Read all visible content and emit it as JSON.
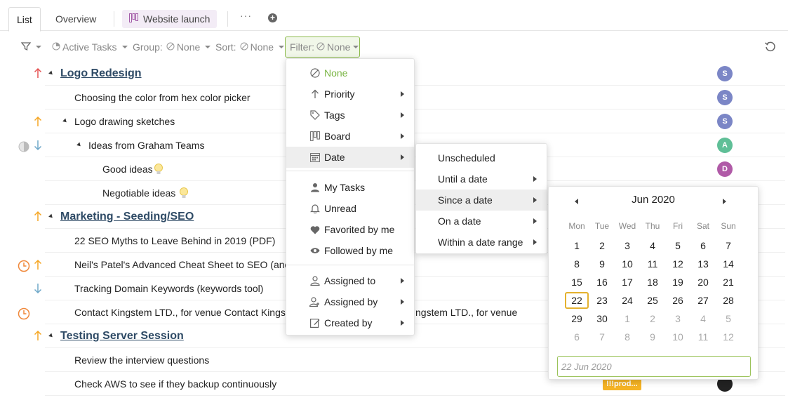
{
  "tabs": {
    "list": "List",
    "overview": "Overview",
    "project": "Website launch",
    "more": "···"
  },
  "toolbar": {
    "active_tasks": "Active Tasks",
    "group": "Group:",
    "group_value": "None",
    "sort": "Sort:",
    "sort_value": "None",
    "filter": "Filter:",
    "filter_value": "None"
  },
  "rows": [
    {
      "text": "Logo Redesign",
      "avatar": "S"
    },
    {
      "text": "Choosing the color from hex color picker",
      "avatar": "S"
    },
    {
      "text": "Logo drawing sketches",
      "avatar": "S"
    },
    {
      "text": "Ideas from Graham Teams",
      "avatar": "A"
    },
    {
      "text": "Good ideas",
      "avatar": "D"
    },
    {
      "text": "Negotiable ideas"
    },
    {
      "text": "Marketing - Seeding/SEO"
    },
    {
      "text": "22 SEO Myths to Leave Behind in 2019 (PDF)"
    },
    {
      "text": "Neil's Patel's Advanced Cheat Sheet to SEO (and"
    },
    {
      "text": "Tracking Domain Keywords (keywords tool)"
    },
    {
      "text": "Contact Kingstem LTD., for venue Contact Kingst",
      "text_tail": "ngstem LTD., for venue"
    },
    {
      "text": "Testing Server Session"
    },
    {
      "text": "Review the interview questions"
    },
    {
      "text": "Check AWS to see if they backup continuously",
      "tag": "!!!prod..."
    }
  ],
  "filter_menu": {
    "none": "None",
    "priority": "Priority",
    "tags": "Tags",
    "board": "Board",
    "date": "Date",
    "my_tasks": "My Tasks",
    "unread": "Unread",
    "favorited": "Favorited by me",
    "followed": "Followed by me",
    "assigned_to": "Assigned to",
    "assigned_by": "Assigned by",
    "created_by": "Created by"
  },
  "date_menu": {
    "unscheduled": "Unscheduled",
    "until": "Until a date",
    "since": "Since a date",
    "on": "On a date",
    "range": "Within a date range"
  },
  "calendar": {
    "title": "Jun 2020",
    "weekdays": [
      "Mon",
      "Tue",
      "Wed",
      "Thu",
      "Fri",
      "Sat",
      "Sun"
    ],
    "weeks": [
      [
        1,
        2,
        3,
        4,
        5,
        6,
        7
      ],
      [
        8,
        9,
        10,
        11,
        12,
        13,
        14
      ],
      [
        15,
        16,
        17,
        18,
        19,
        20,
        21
      ],
      [
        22,
        23,
        24,
        25,
        26,
        27,
        28
      ],
      [
        29,
        30,
        1,
        2,
        3,
        4,
        5
      ],
      [
        6,
        7,
        8,
        9,
        10,
        11,
        12
      ]
    ],
    "selected": 22,
    "input_value": "22 Jun 2020"
  },
  "colors": {
    "accent_green": "#8dbb4d",
    "none_green": "#79b543",
    "group_title": "#2f4b66",
    "priority_high": "#e55353",
    "priority_med": "#f5a623",
    "priority_low": "#6fa8c9",
    "avatar_s": "#7b86c6",
    "avatar_a": "#5fbf97",
    "avatar_d": "#b05aa7",
    "project_tab_bg": "#f3ecf6",
    "project_icon": "#a35ca8",
    "selected_day": "#e4b12e"
  }
}
